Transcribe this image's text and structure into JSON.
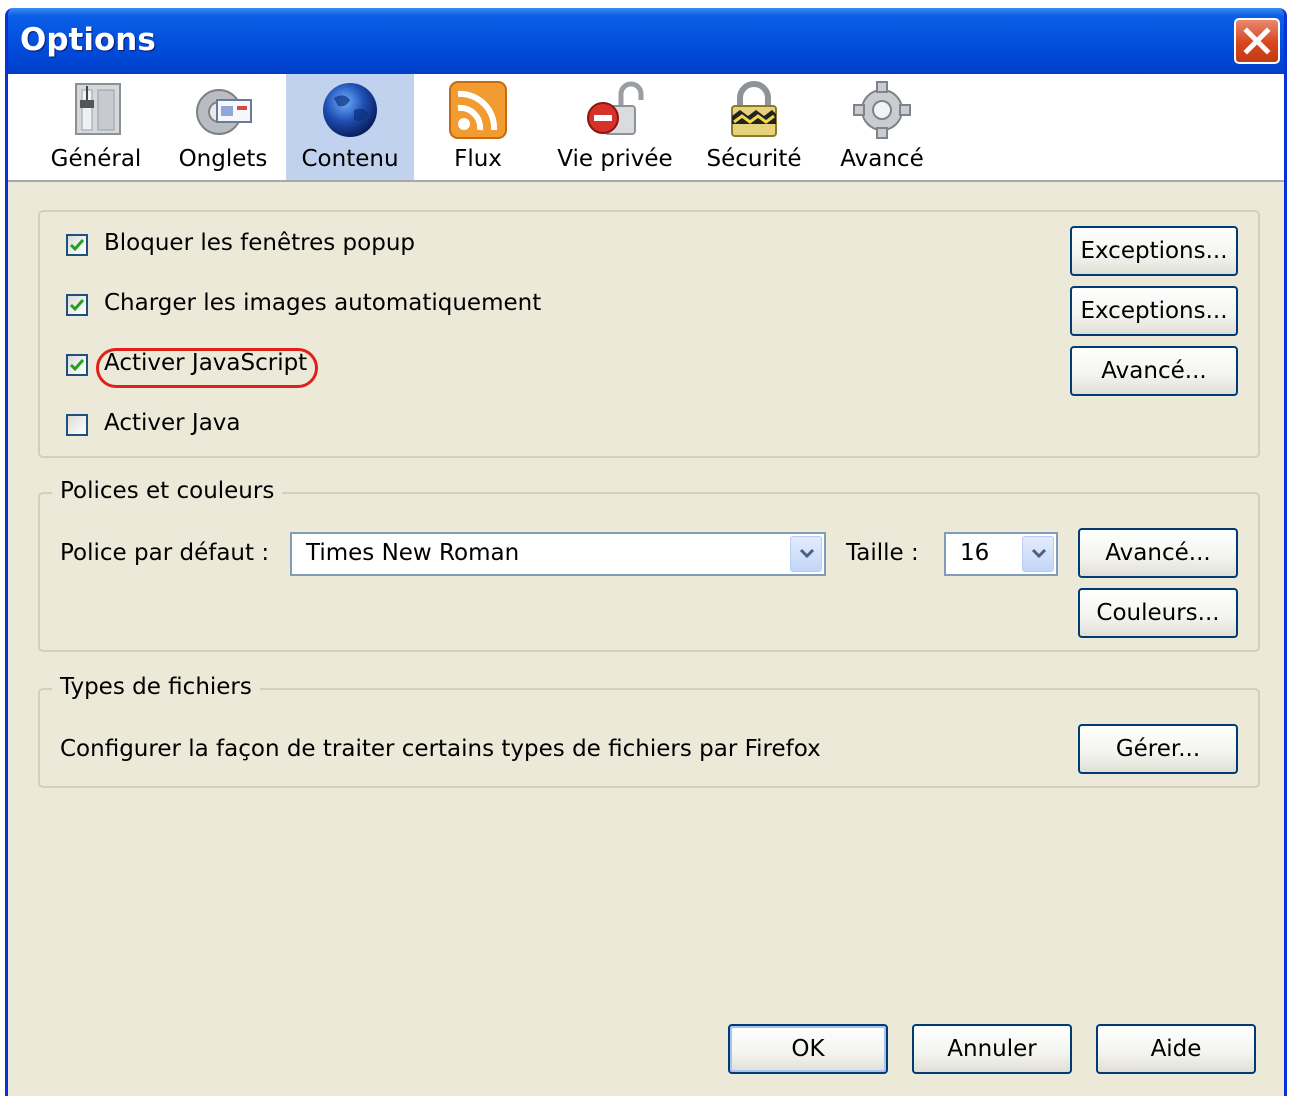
{
  "window": {
    "title": "Options"
  },
  "tabs": [
    {
      "label": "Général",
      "icon": "general-switch-icon"
    },
    {
      "label": "Onglets",
      "icon": "tabs-gear-icon"
    },
    {
      "label": "Contenu",
      "icon": "globe-icon",
      "selected": true
    },
    {
      "label": "Flux",
      "icon": "rss-feed-icon"
    },
    {
      "label": "Vie privée",
      "icon": "private-lock-icon"
    },
    {
      "label": "Sécurité",
      "icon": "security-padlock-icon"
    },
    {
      "label": "Avancé",
      "icon": "advanced-gear-icon"
    }
  ],
  "content": {
    "block_popups": {
      "label": "Bloquer les fenêtres popup",
      "checked": true,
      "button": "Exceptions..."
    },
    "load_images": {
      "label": "Charger les images automatiquement",
      "checked": true,
      "button": "Exceptions..."
    },
    "enable_js": {
      "label": "Activer JavaScript",
      "checked": true,
      "button": "Avancé..."
    },
    "enable_java": {
      "label": "Activer Java",
      "checked": false
    }
  },
  "fonts": {
    "legend": "Polices et couleurs",
    "default_font_label": "Police par défaut :",
    "default_font_value": "Times New Roman",
    "size_label": "Taille :",
    "size_value": "16",
    "advanced_button": "Avancé...",
    "colors_button": "Couleurs..."
  },
  "file_types": {
    "legend": "Types de fichiers",
    "description": "Configurer la façon de traiter certains types de fichiers par Firefox",
    "manage_button": "Gérer..."
  },
  "footer": {
    "ok": "OK",
    "cancel": "Annuler",
    "help": "Aide"
  },
  "colors": {
    "title_bar": "#0554e0",
    "selected_tab": "#c1d2ee",
    "dialog_bg": "#ece9d8",
    "highlight": "#e0201a"
  }
}
